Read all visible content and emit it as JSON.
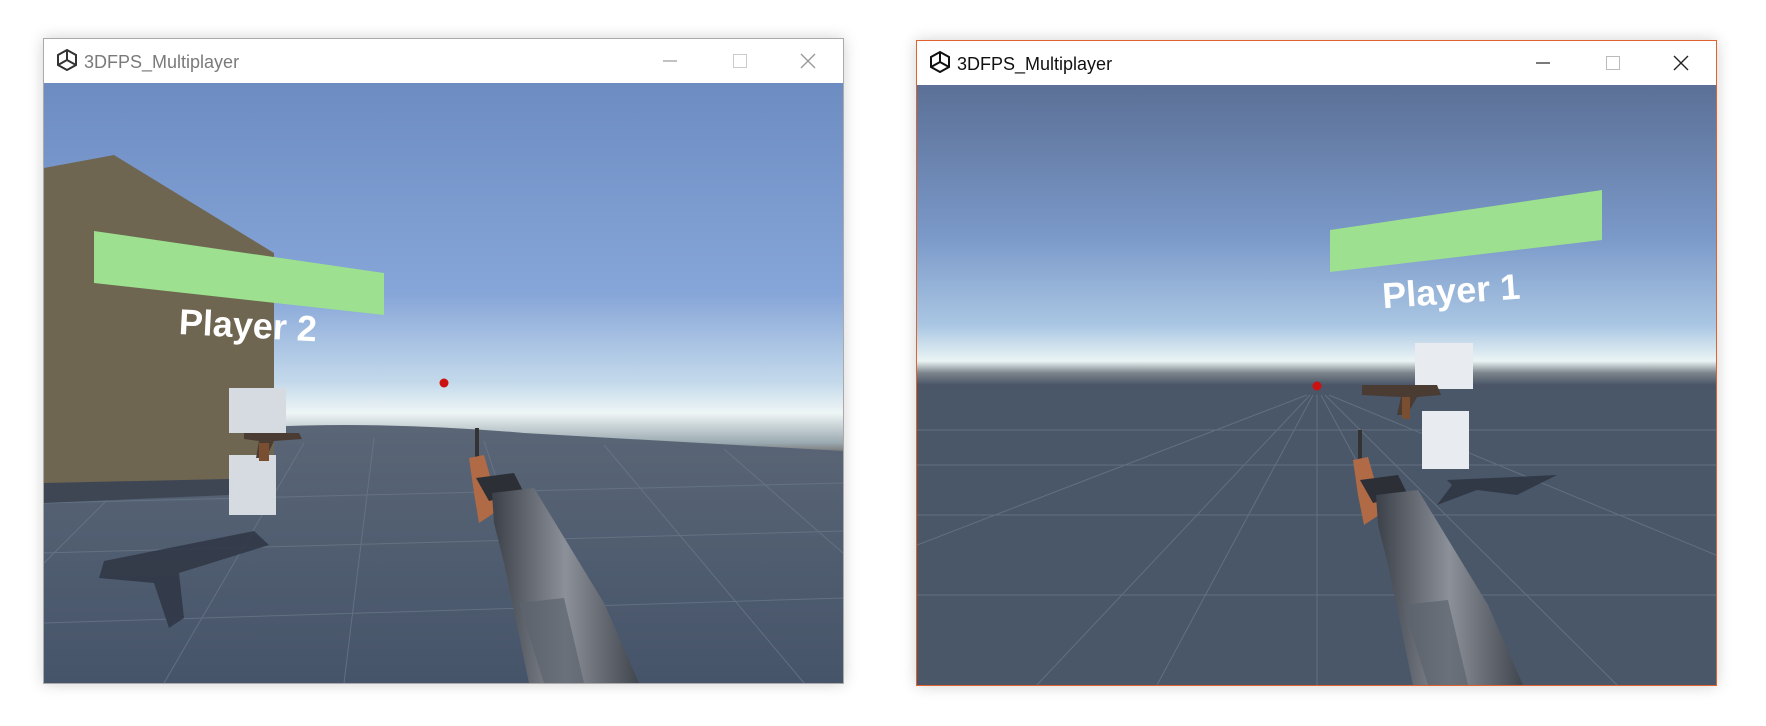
{
  "windows": [
    {
      "title": "3DFPS_Multiplayer",
      "nametag": "Player 2",
      "active": false
    },
    {
      "title": "3DFPS_Multiplayer",
      "nametag": "Player 1",
      "active": true
    }
  ],
  "icons": {
    "app": "unity-logo-icon",
    "minimize": "minimize-icon",
    "maximize": "maximize-icon",
    "close": "close-icon"
  },
  "colors": {
    "active_border": "#e0622e",
    "health_bar": "#9de08f",
    "crosshair": "#cc1111",
    "sky_top": "#6f8fc4",
    "ground": "#4a5869"
  }
}
